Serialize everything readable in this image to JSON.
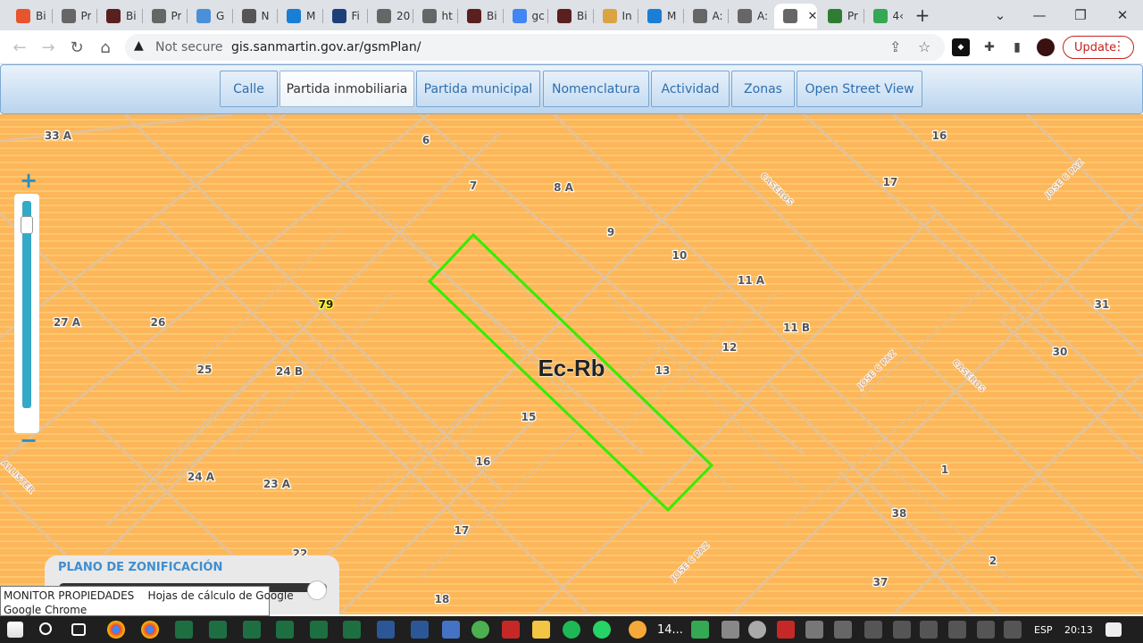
{
  "browser": {
    "tabs": [
      {
        "label": "Bi",
        "color": "#e8542e"
      },
      {
        "label": "Pr",
        "color": "#666666"
      },
      {
        "label": "Bi",
        "color": "#5a1f1f"
      },
      {
        "label": "Pr",
        "color": "#666666"
      },
      {
        "label": "G",
        "color": "#4a90d9"
      },
      {
        "label": "N",
        "color": "#555555"
      },
      {
        "label": "M",
        "color": "#1a7ed4"
      },
      {
        "label": "Fi",
        "color": "#1c3f7a"
      },
      {
        "label": "20",
        "color": "#666666"
      },
      {
        "label": "ht",
        "color": "#666666"
      },
      {
        "label": "Bi",
        "color": "#5a1f1f"
      },
      {
        "label": "gc",
        "color": "#4285f4"
      },
      {
        "label": "Bi",
        "color": "#5a1f1f"
      },
      {
        "label": "In",
        "color": "#d9a441"
      },
      {
        "label": "M",
        "color": "#1a7ed4"
      },
      {
        "label": "A:",
        "color": "#666666"
      },
      {
        "label": "A:",
        "color": "#666666"
      },
      {
        "label": "",
        "color": "#666666"
      },
      {
        "label": "Pr",
        "color": "#2e7d32"
      },
      {
        "label": "4‹",
        "color": "#34a853"
      }
    ],
    "new_tab": "+",
    "tab_search": "⌄",
    "window_controls": {
      "minimize": "—",
      "maximize": "❐",
      "close": "✕"
    },
    "nav": {
      "back": "←",
      "forward": "→",
      "reload": "↻",
      "home": "⌂"
    },
    "omnibox": {
      "security_icon": "▲",
      "security_text": "Not secure",
      "url": "gis.sanmartin.gov.ar/gsmPlan/",
      "share": "⇪",
      "star": "☆"
    },
    "update_label": "Update",
    "update_menu": "⋮"
  },
  "app": {
    "nav_tabs": [
      "Calle",
      "Partida inmobiliaria",
      "Partida municipal",
      "Nomenclatura",
      "Actividad",
      "Zonas",
      "Open Street View"
    ],
    "selected_tab": "Partida inmobiliaria"
  },
  "map": {
    "zone_label": "Ec-Rb",
    "highlight_color": "#33ee00",
    "base_color": "#fdb659",
    "parcel_labels": [
      "33 A",
      "6",
      "16",
      "7",
      "8 A",
      "17",
      "9",
      "10",
      "11 A",
      "31",
      "79",
      "27 A",
      "26",
      "11 B",
      "30",
      "12",
      "13",
      "25",
      "24 B",
      "15",
      "16",
      "1",
      "24 A",
      "23 A",
      "38",
      "17",
      "2",
      "18",
      "37",
      "22"
    ],
    "street_labels": [
      "CASEROS",
      "JOSE C PAZ",
      "JOSE C PAZ",
      "CASEROS",
      "JOSE C PAZ",
      "ALLISTER"
    ],
    "zoom_in": "+",
    "zoom_out": "−",
    "zoom_fraction": 0.92
  },
  "legend": {
    "title": "PLANO DE ZONIFICACIÓN",
    "slider_fraction": 0.97
  },
  "tooltip": {
    "line1": "MONITOR PROPIEDADES    Hojas de cálculo de Google",
    "line2": "Google Chrome"
  },
  "taskbar": {
    "weather": "14...",
    "lang": "ESP",
    "time": "20:13"
  }
}
